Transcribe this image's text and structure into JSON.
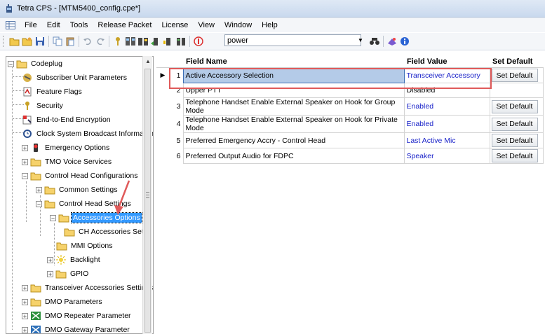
{
  "window": {
    "title": "Tetra CPS - [MTM5400_config.cpe*]"
  },
  "menu": [
    "File",
    "Edit",
    "Tools",
    "Release Packet",
    "License",
    "View",
    "Window",
    "Help"
  ],
  "toolbar": {
    "search_value": "power"
  },
  "tree": {
    "nodes": [
      {
        "label": "Codeplug",
        "icon": "folder-icon",
        "expander": "minus"
      },
      {
        "label": "Subscriber Unit Parameters",
        "icon": "radio-icon"
      },
      {
        "label": "Feature Flags",
        "icon": "flags-icon"
      },
      {
        "label": "Security",
        "icon": "key-icon"
      },
      {
        "label": "End-to-End Encryption",
        "icon": "encryption-icon"
      },
      {
        "label": "Clock System Broadcast Information",
        "icon": "clock-icon"
      },
      {
        "label": "Emergency Options",
        "icon": "emergency-icon",
        "expander": "plus"
      },
      {
        "label": "TMO Voice Services",
        "icon": "folder-icon",
        "expander": "plus"
      },
      {
        "label": "Control Head Configurations",
        "icon": "folder-icon",
        "expander": "minus"
      },
      {
        "label": "Common Settings",
        "icon": "folder-icon",
        "expander": "plus"
      },
      {
        "label": "Control Head Settings",
        "icon": "folder-icon",
        "expander": "minus"
      },
      {
        "label": "Accessories Options",
        "icon": "folder-icon",
        "expander": "minus",
        "selected": true
      },
      {
        "label": "CH Accessories Setup",
        "icon": "folder-icon"
      },
      {
        "label": "MMI Options",
        "icon": "folder-icon"
      },
      {
        "label": "Backlight",
        "icon": "backlight-icon",
        "expander": "plus"
      },
      {
        "label": "GPIO",
        "icon": "folder-icon",
        "expander": "plus"
      },
      {
        "label": "Transceiver Accessories Settings",
        "icon": "folder-icon",
        "expander": "plus"
      },
      {
        "label": "DMO Parameters",
        "icon": "folder-icon",
        "expander": "plus"
      },
      {
        "label": "DMO Repeater Parameter",
        "icon": "repeater-icon",
        "expander": "plus"
      },
      {
        "label": "DMO Gateway Parameter",
        "icon": "gateway-icon",
        "expander": "plus"
      }
    ]
  },
  "grid": {
    "columns": [
      "Field Name",
      "Field Value",
      "Set Default"
    ],
    "set_default_label": "Set Default",
    "rows": [
      {
        "num": "1",
        "field": "Active Accessory Selection",
        "value": "Transceiver Accessory",
        "value_blue": true,
        "has_default": true
      },
      {
        "num": "2",
        "field": "Upper PTT",
        "value": "Disabled",
        "value_blue": false,
        "has_default": false
      },
      {
        "num": "3",
        "field": "Telephone Handset Enable External Speaker on Hook for Group Mode",
        "value": "Enabled",
        "value_blue": true,
        "has_default": true
      },
      {
        "num": "4",
        "field": "Telephone Handset Enable External Speaker on Hook for Private Mode",
        "value": "Enabled",
        "value_blue": true,
        "has_default": true
      },
      {
        "num": "5",
        "field": "Preferred Emergency Accry - Control Head",
        "value": "Last Active Mic",
        "value_blue": true,
        "has_default": true
      },
      {
        "num": "6",
        "field": "Preferred Output Audio for FDPC",
        "value": "Speaker",
        "value_blue": true,
        "has_default": true
      }
    ]
  },
  "colors": {
    "selection": "#3399ff",
    "value_blue": "#1a23c9",
    "annotation_red": "#e05a5a"
  }
}
